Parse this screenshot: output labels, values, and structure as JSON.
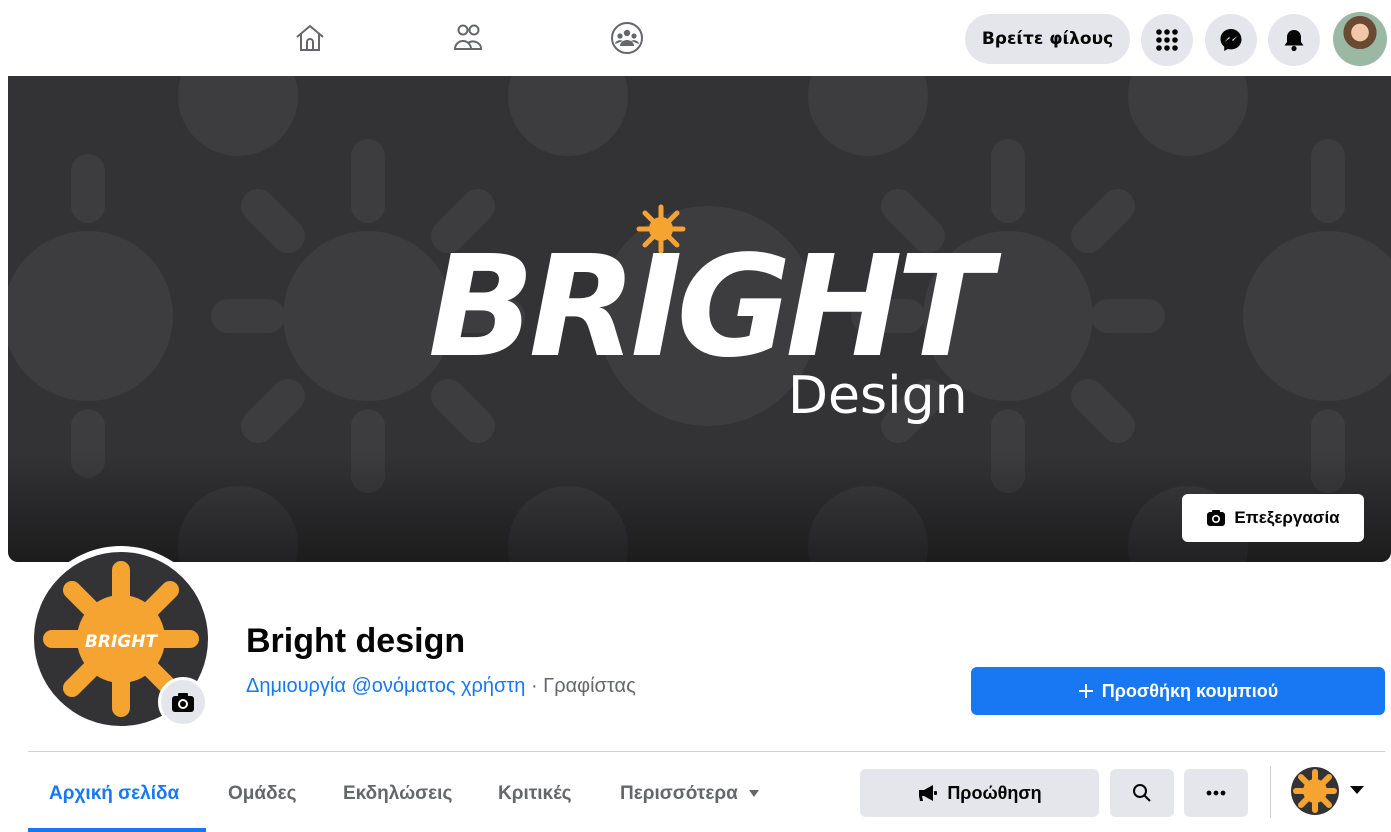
{
  "topbar": {
    "nav_icons": [
      "home-icon",
      "friends-icon",
      "groups-icon"
    ],
    "find_friends_label": "Βρείτε φίλους",
    "menu_icon": "grid-menu-icon",
    "messenger_icon": "messenger-icon",
    "notifications_icon": "bell-icon"
  },
  "cover": {
    "logo_text": "BRIGHT",
    "logo_subtext": "Design",
    "edit_label": "Επεξεργασία",
    "edit_icon": "camera-icon",
    "background_color": "#333335",
    "sun_color": "#f5a331"
  },
  "profile": {
    "logo_text": "BRIGHT",
    "camera_icon": "camera-icon",
    "name": "Bright design",
    "username_link": "Δημιουργία @ονόματος χρήστη",
    "separator": " · ",
    "category": "Γραφίστας",
    "add_button_label": "Προσθήκη κουμπιού",
    "add_button_icon": "plus-icon"
  },
  "tabs": [
    {
      "label": "Αρχική σελίδα",
      "active": true
    },
    {
      "label": "Ομάδες",
      "active": false
    },
    {
      "label": "Εκδηλώσεις",
      "active": false
    },
    {
      "label": "Κριτικές",
      "active": false
    },
    {
      "label": "Περισσότερα",
      "active": false
    }
  ],
  "actions": {
    "promote_label": "Προώθηση",
    "promote_icon": "megaphone-icon",
    "search_icon": "search-icon",
    "more_icon": "ellipsis-icon"
  },
  "colors": {
    "accent": "#1877f2",
    "button_gray": "#e4e6eb",
    "secondary_text": "#65676b"
  }
}
